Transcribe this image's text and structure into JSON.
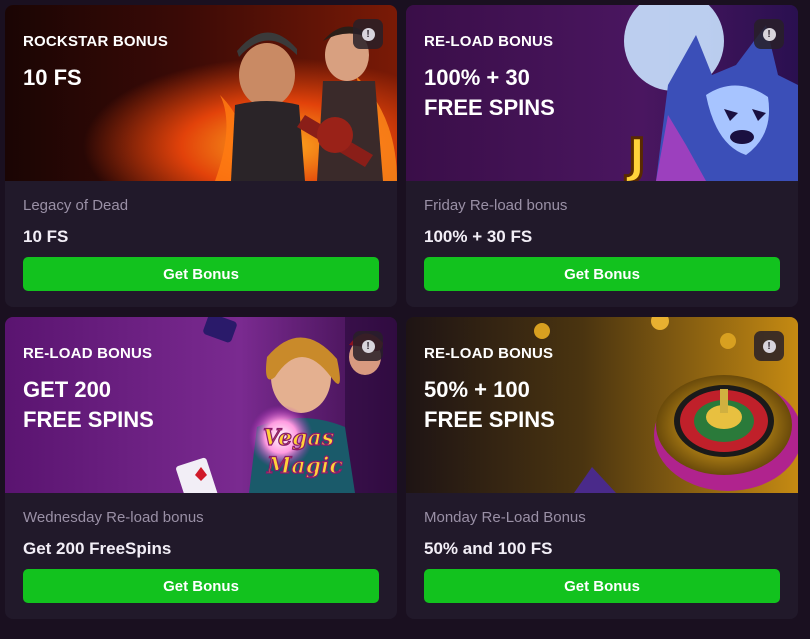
{
  "cards": [
    {
      "category": "ROCKSTAR BONUS",
      "banner_title": "10 FS",
      "game": "Legacy of Dead",
      "offer": "10 FS",
      "button": "Get Bonus",
      "info_icon": "exclamation-icon"
    },
    {
      "category": "RE-LOAD BONUS",
      "banner_title": "100% + 30\nFREE SPINS",
      "game": "Friday Re-load bonus",
      "offer": "100% + 30 FS",
      "button": "Get Bonus",
      "info_icon": "exclamation-icon"
    },
    {
      "category": "RE-LOAD BONUS",
      "banner_title": "GET 200\nFREE SPINS",
      "game": "Wednesday Re-load bonus",
      "offer": "Get 200 FreeSpins",
      "button": "Get Bonus",
      "info_icon": "exclamation-icon",
      "logo_text": "Vegas Magic"
    },
    {
      "category": "RE-LOAD BONUS",
      "banner_title": "50% + 100\nFREE SPINS",
      "game": "Monday Re-Load Bonus",
      "offer": "50% and 100 FS",
      "button": "Get Bonus",
      "info_icon": "exclamation-icon"
    }
  ],
  "colors": {
    "page_bg": "#1a1020",
    "card_bg": "#21192a",
    "button_green": "#12c21e",
    "muted_text": "#9a90a6"
  }
}
